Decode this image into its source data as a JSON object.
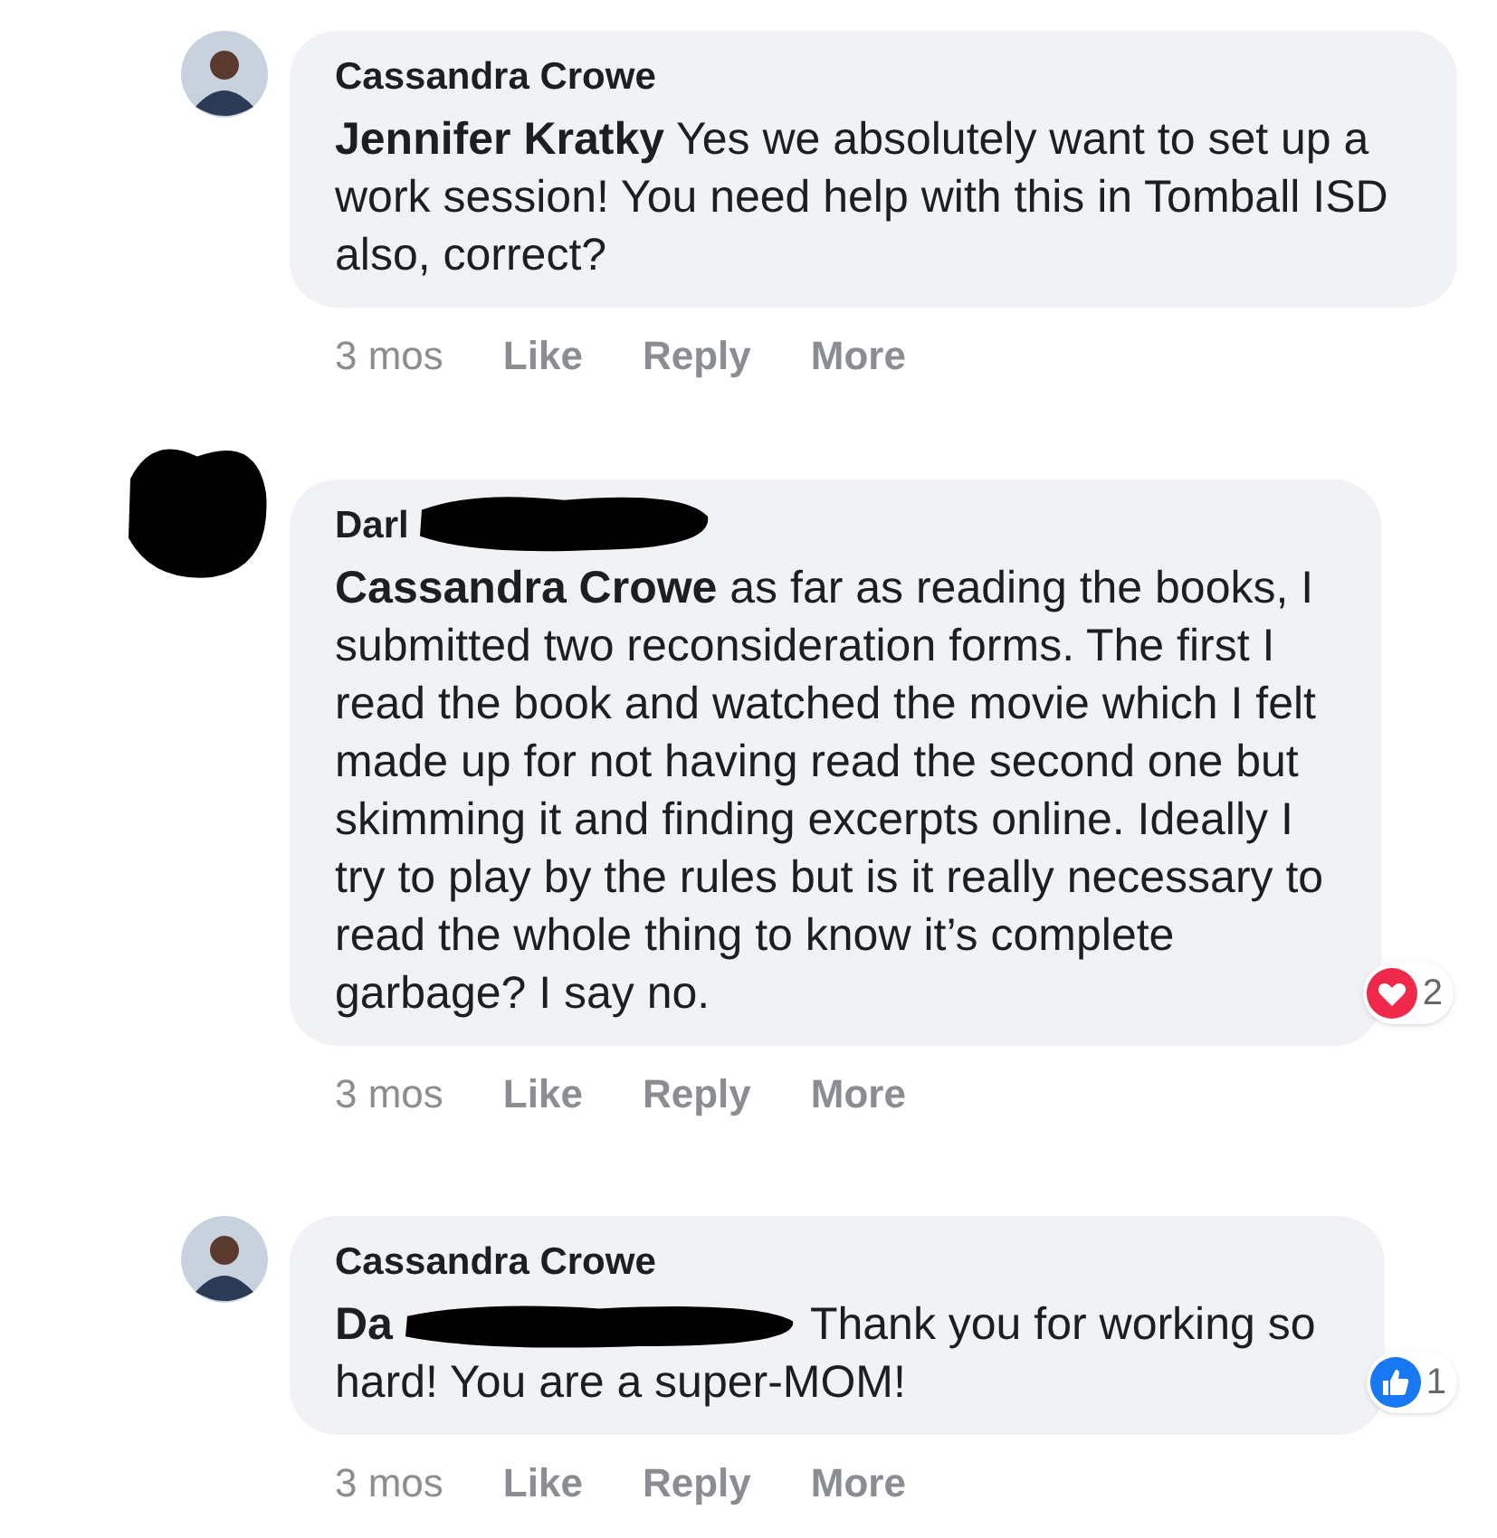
{
  "comments": [
    {
      "author": "Cassandra Crowe",
      "author_redacted": false,
      "avatar_redacted": false,
      "mention": "Jennifer Kratky",
      "mention_redacted": false,
      "text": "Yes we absolutely want to set up a work session! You need help with this in Tomball ISD also, correct?",
      "time": "3 mos",
      "actions": [
        "Like",
        "Reply",
        "More"
      ]
    },
    {
      "author": "Darl",
      "author_redacted": true,
      "avatar_redacted": true,
      "mention": "Cassandra Crowe",
      "mention_redacted": false,
      "text": "as far as reading the books, I submitted two reconsideration forms. The first I read the book and watched the movie which I felt made up for not having read the second one but skimming it and finding excerpts online. Ideally I try to play by the rules but is it really necessary to read the whole thing to know it’s complete garbage? I say no.",
      "reaction": {
        "kind": "love",
        "count": "2"
      },
      "time": "3 mos",
      "actions": [
        "Like",
        "Reply",
        "More"
      ]
    },
    {
      "author": "Cassandra Crowe",
      "author_redacted": false,
      "avatar_redacted": false,
      "mention": "Da",
      "mention_redacted": true,
      "text": "Thank you for working so hard! You are a super-MOM!",
      "reaction": {
        "kind": "like",
        "count": "1"
      },
      "time": "3 mos",
      "actions": [
        "Like",
        "Reply",
        "More"
      ]
    }
  ]
}
